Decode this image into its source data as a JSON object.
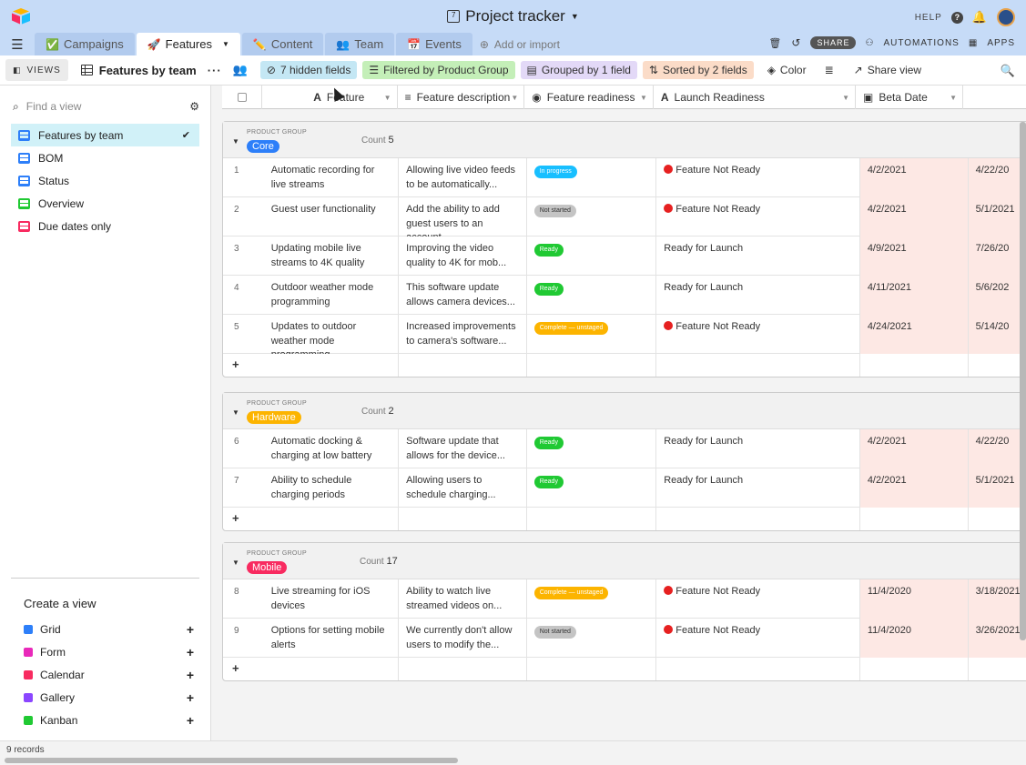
{
  "app": {
    "title": "Project tracker",
    "help_label": "HELP",
    "share_label": "SHARE",
    "automations_label": "AUTOMATIONS",
    "apps_label": "APPS"
  },
  "tabs": [
    {
      "label": "Campaigns",
      "icon": "✅",
      "active": false
    },
    {
      "label": "Features",
      "icon": "🚀",
      "active": true
    },
    {
      "label": "Content",
      "icon": "✏️",
      "active": false
    },
    {
      "label": "Team",
      "icon": "👥",
      "active": false
    },
    {
      "label": "Events",
      "icon": "📅",
      "active": false
    }
  ],
  "add_import_label": "Add or import",
  "toolbar": {
    "views_label": "VIEWS",
    "view_name": "Features by team",
    "hidden_fields": "7 hidden fields",
    "filtered": "Filtered by Product Group",
    "grouped": "Grouped by 1 field",
    "sorted": "Sorted by 2 fields",
    "color": "Color",
    "share_view": "Share view"
  },
  "sidebar": {
    "find_placeholder": "Find a view",
    "views": [
      {
        "label": "Features by team",
        "color": "#2d7ff9",
        "active": true
      },
      {
        "label": "BOM",
        "color": "#2d7ff9",
        "active": false
      },
      {
        "label": "Status",
        "color": "#2d7ff9",
        "active": false
      },
      {
        "label": "Overview",
        "color": "#20c933",
        "active": false
      },
      {
        "label": "Due dates only",
        "color": "#f82b60",
        "active": false
      }
    ],
    "create_header": "Create a view",
    "create_items": [
      {
        "label": "Grid",
        "color": "#2d7ff9"
      },
      {
        "label": "Form",
        "color": "#e929ba"
      },
      {
        "label": "Calendar",
        "color": "#f82b60"
      },
      {
        "label": "Gallery",
        "color": "#8b46ff"
      },
      {
        "label": "Kanban",
        "color": "#20c933"
      }
    ]
  },
  "columns": {
    "feature": "Feature",
    "description": "Feature description",
    "readiness": "Feature readiness",
    "launch": "Launch Readiness",
    "beta": "Beta Date"
  },
  "group_label": "PRODUCT GROUP",
  "count_label": "Count",
  "groups": [
    {
      "name": "Core",
      "color": "#2d7ff9",
      "count": "5",
      "rows": [
        {
          "num": "1",
          "feature": "Automatic recording for live streams",
          "desc": "Allowing live video feeds to be automatically...",
          "ready": "In progress",
          "ready_color": "#18bfff",
          "launch": "Feature Not Ready",
          "launch_dot": true,
          "beta": "4/2/2021",
          "next": "4/22/20"
        },
        {
          "num": "2",
          "feature": "Guest user functionality",
          "desc": "Add the ability to add guest users to an account",
          "ready": "Not started",
          "ready_color": "#c4c4c4",
          "launch": "Feature Not Ready",
          "launch_dot": true,
          "beta": "4/2/2021",
          "next": "5/1/2021"
        },
        {
          "num": "3",
          "feature": "Updating mobile live streams to 4K quality",
          "desc": "Improving the video quality to 4K for mob...",
          "ready": "Ready",
          "ready_color": "#20c933",
          "launch": "Ready for Launch",
          "launch_dot": false,
          "beta": "4/9/2021",
          "next": "7/26/20"
        },
        {
          "num": "4",
          "feature": "Outdoor weather mode programming",
          "desc": "This software update allows camera devices...",
          "ready": "Ready",
          "ready_color": "#20c933",
          "launch": "Ready for Launch",
          "launch_dot": false,
          "beta": "4/11/2021",
          "next": "5/6/202"
        },
        {
          "num": "5",
          "feature": "Updates to outdoor weather mode programming",
          "desc": "Increased improvements to camera's software...",
          "ready": "Complete — unstaged",
          "ready_color": "#fcb400",
          "launch": "Feature Not Ready",
          "launch_dot": true,
          "beta": "4/24/2021",
          "next": "5/14/20"
        }
      ]
    },
    {
      "name": "Hardware",
      "color": "#fcb400",
      "count": "2",
      "rows": [
        {
          "num": "6",
          "feature": "Automatic docking & charging at low battery",
          "desc": "Software update that allows for the device...",
          "ready": "Ready",
          "ready_color": "#20c933",
          "launch": "Ready for Launch",
          "launch_dot": false,
          "beta": "4/2/2021",
          "next": "4/22/20"
        },
        {
          "num": "7",
          "feature": "Ability to schedule charging periods",
          "desc": "Allowing users to schedule charging...",
          "ready": "Ready",
          "ready_color": "#20c933",
          "launch": "Ready for Launch",
          "launch_dot": false,
          "beta": "4/2/2021",
          "next": "5/1/2021"
        }
      ]
    },
    {
      "name": "Mobile",
      "color": "#f82b60",
      "count": "17",
      "rows": [
        {
          "num": "8",
          "feature": "Live streaming for iOS devices",
          "desc": "Ability to watch live streamed videos on...",
          "ready": "Complete — unstaged",
          "ready_color": "#fcb400",
          "launch": "Feature Not Ready",
          "launch_dot": true,
          "beta": "11/4/2020",
          "next": "3/18/2021"
        },
        {
          "num": "9",
          "feature": "Options for setting mobile alerts",
          "desc": "We currently don't allow users to modify the...",
          "ready": "Not started",
          "ready_color": "#c4c4c4",
          "launch": "Feature Not Ready",
          "launch_dot": true,
          "beta": "11/4/2020",
          "next": "3/26/2021"
        }
      ]
    }
  ],
  "footer": {
    "records": "9 records"
  }
}
